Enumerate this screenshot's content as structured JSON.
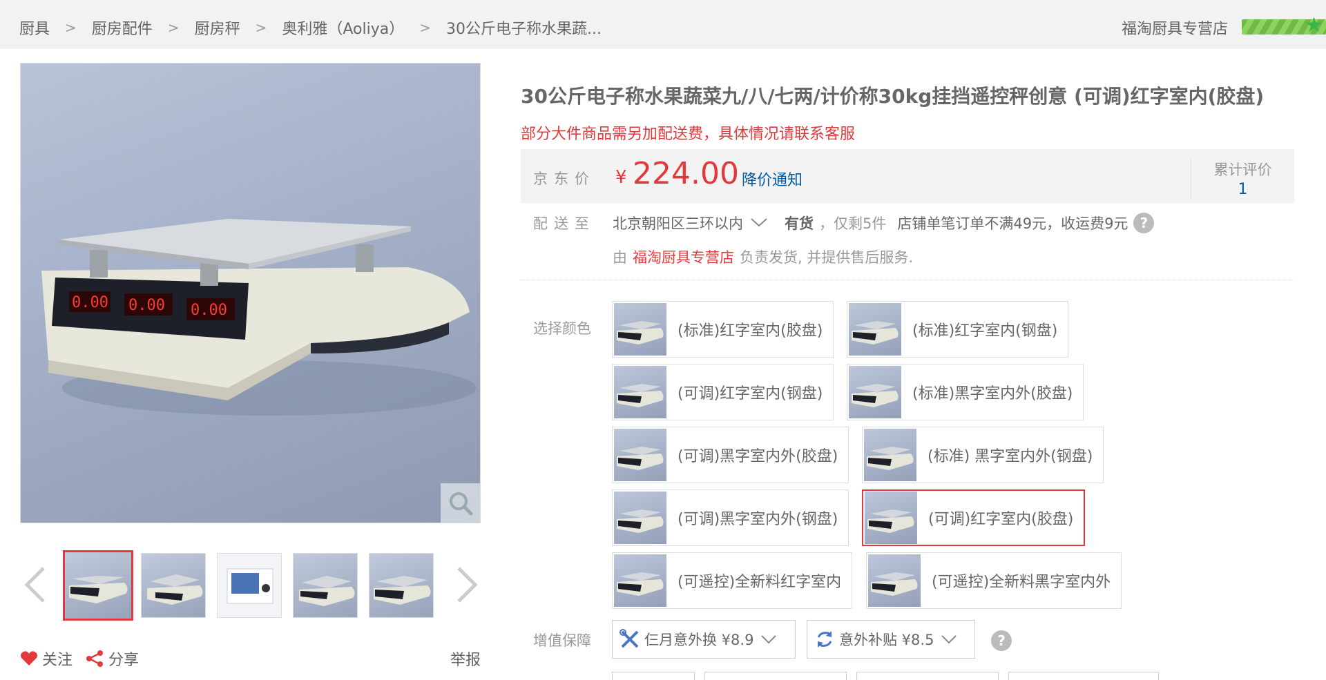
{
  "breadcrumb": [
    "厨具",
    "厨房配件",
    "厨房秤",
    "奥利雅（Aoliya）",
    "30公斤电子称水果蔬..."
  ],
  "breadcrumb_separator": ">",
  "header": {
    "shop_name": "福淘厨具专营店",
    "rating_icon": "star-icon"
  },
  "gallery": {
    "zoom_icon": "magnifier-icon",
    "prev_icon": "chevron-left-icon",
    "next_icon": "chevron-right-icon",
    "thumbnails": [
      "scale-front",
      "scale-angle",
      "scale-box",
      "scale-side",
      "scale-angle-2"
    ],
    "selected_index": 0
  },
  "actions": {
    "follow": "关注",
    "share": "分享",
    "report": "举报"
  },
  "product": {
    "title": "30公斤电子称水果蔬菜九/八/七两/计价称30kg挂挡遥控秤创意 (可调)红字室内(胶盘)",
    "promo": "部分大件商品需另加配送费，具体情况请联系客服"
  },
  "price": {
    "label": "京东价",
    "currency": "¥",
    "value": "224.00",
    "notify": "降价通知",
    "reviews_label": "累计评价",
    "reviews_count": "1"
  },
  "delivery": {
    "label": "配送至",
    "address": "北京朝阳区三环以内",
    "stock": "有货",
    "remaining": "，仅剩5件",
    "freight": "店铺单笔订单不满49元，收运费9元",
    "help_icon": "question-icon",
    "by": "由",
    "shop": "福淘厨具专营店",
    "service": "负责发货, 并提供售后服务."
  },
  "color": {
    "label": "选择颜色",
    "options": [
      "(标准)红字室内(胶盘)",
      "(标准)红字室内(钢盘)",
      "(可调)红字室内(钢盘)",
      "(标准)黑字室内外(胶盘)",
      "(可调)黑字室内外(胶盘)",
      "(标准) 黑字室内外(钢盘)",
      "(可调)黑字室内外(钢盘)",
      "(可调)红字室内(胶盘)",
      "(可遥控)全新料红字室内",
      "(可遥控)全新料黑字室内外"
    ],
    "selected_index": 7
  },
  "value_added": {
    "label": "增值保障",
    "items": [
      {
        "label": "仨月意外换 ¥8.9",
        "icon": "tools-icon"
      },
      {
        "label": "意外补贴 ¥8.5",
        "icon": "refresh-icon"
      }
    ]
  },
  "colors": {
    "accent": "#e4393c",
    "link": "#005aa0",
    "muted": "#999999"
  }
}
